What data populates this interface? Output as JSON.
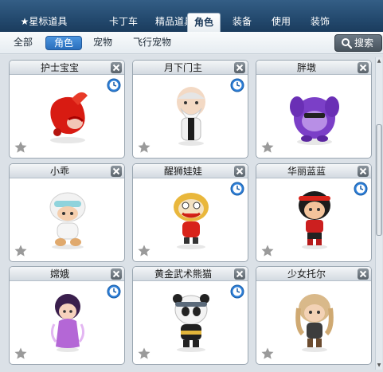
{
  "tabs": [
    {
      "label": "★星标道具",
      "active": false
    },
    {
      "label": "卡丁车",
      "active": false
    },
    {
      "label": "精品道具",
      "active": false
    },
    {
      "label": "角色",
      "active": true
    },
    {
      "label": "装备",
      "active": false
    },
    {
      "label": "使用",
      "active": false
    },
    {
      "label": "装饰",
      "active": false
    }
  ],
  "subtabs": [
    {
      "label": "全部",
      "active": false
    },
    {
      "label": "角色",
      "active": true
    },
    {
      "label": "宠物",
      "active": false
    },
    {
      "label": "飞行宠物",
      "active": false
    }
  ],
  "search": {
    "label": "搜索",
    "icon": "magnifier-icon"
  },
  "items": [
    {
      "name": "护士宝宝",
      "timed": true,
      "figure": "red-hood-baby"
    },
    {
      "name": "月下门主",
      "timed": true,
      "figure": "white-bearded-elder"
    },
    {
      "name": "胖墩",
      "timed": false,
      "figure": "purple-chubby"
    },
    {
      "name": "小乖",
      "timed": false,
      "figure": "white-cap-kid"
    },
    {
      "name": "醒狮娃娃",
      "timed": true,
      "figure": "lion-dance-kid"
    },
    {
      "name": "华丽蓝蓝",
      "timed": true,
      "figure": "headband-girl"
    },
    {
      "name": "嫦娥",
      "timed": true,
      "figure": "purple-fairy"
    },
    {
      "name": "黄金武术熊猫",
      "timed": true,
      "figure": "kungfu-panda"
    },
    {
      "name": "少女托尔",
      "timed": false,
      "figure": "blonde-girl"
    }
  ],
  "colors": {
    "tab_bar": "#23496e",
    "subtab_active": "#2a6fbd",
    "clock": "#2d7fd8",
    "star": "#9a9a9a"
  }
}
